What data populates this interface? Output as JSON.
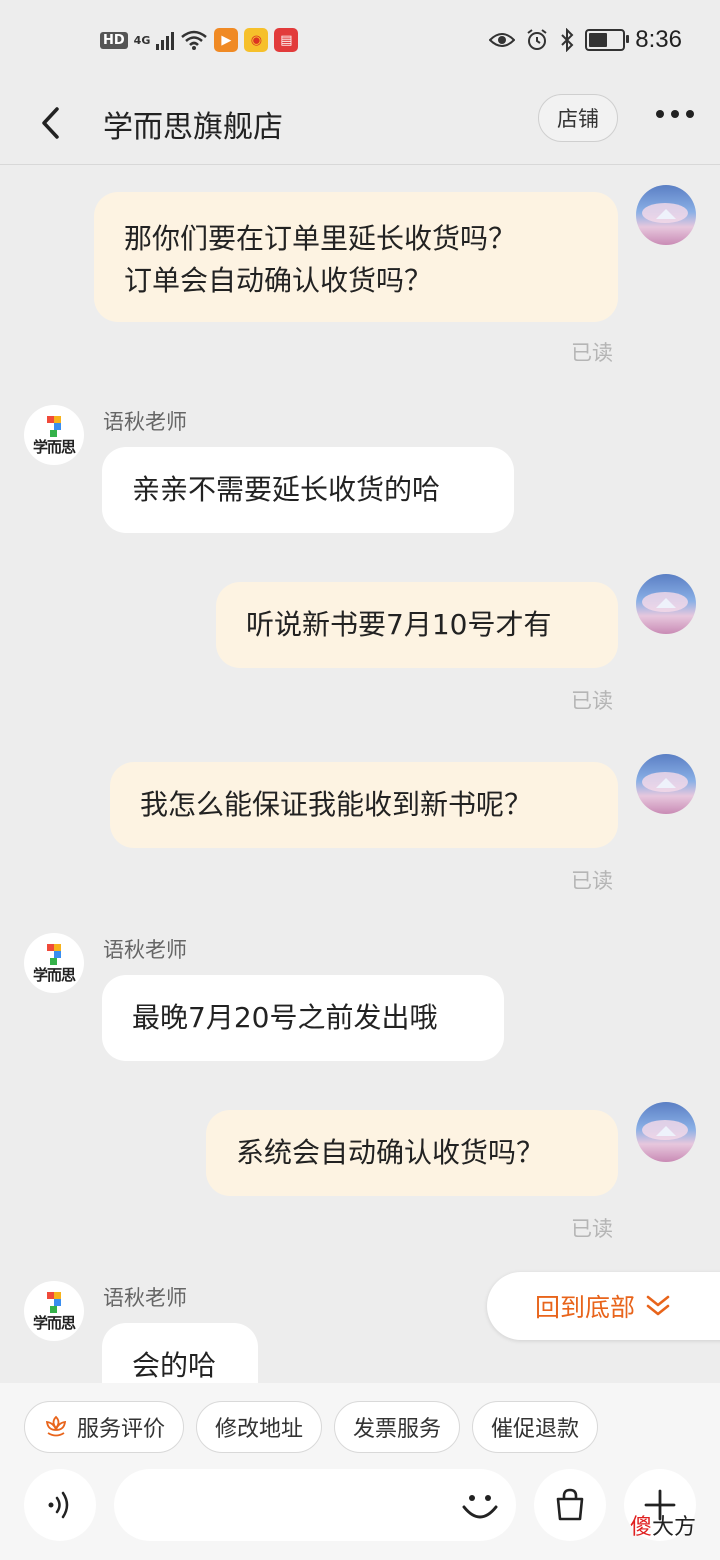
{
  "status_bar": {
    "hd": "HD",
    "network": "4G",
    "time": "8:36",
    "battery_level": 0.65
  },
  "header": {
    "title": "学而思旗舰店",
    "shop_button": "店铺"
  },
  "messages": [
    {
      "side": "me",
      "lines": [
        "那你们要在订单里延长收货吗？",
        "订单会自动确认收货吗？"
      ],
      "read": "已读"
    },
    {
      "side": "them",
      "sender": "语秋老师",
      "text": "亲亲不需要延长收货的哈"
    },
    {
      "side": "me",
      "text": "听说新书要7月10号才有",
      "read": "已读"
    },
    {
      "side": "me",
      "text": "我怎么能保证我能收到新书呢？",
      "read": "已读"
    },
    {
      "side": "them",
      "sender": "语秋老师",
      "text": "最晚7月20号之前发出哦"
    },
    {
      "side": "me",
      "text": "系统会自动确认收货吗？",
      "read": "已读"
    },
    {
      "side": "them",
      "sender": "语秋老师",
      "text": "会的哈"
    }
  ],
  "shop_logo_text": "学而思",
  "to_bottom": "回到底部",
  "quick_actions": [
    "服务评价",
    "修改地址",
    "发票服务",
    "催促退款"
  ],
  "watermark": {
    "red": "傻",
    "black": "大方"
  },
  "colors": {
    "accent": "#e8641b",
    "my_bubble": "#fdf3e2",
    "their_bubble": "#ffffff",
    "background": "#ededed"
  }
}
